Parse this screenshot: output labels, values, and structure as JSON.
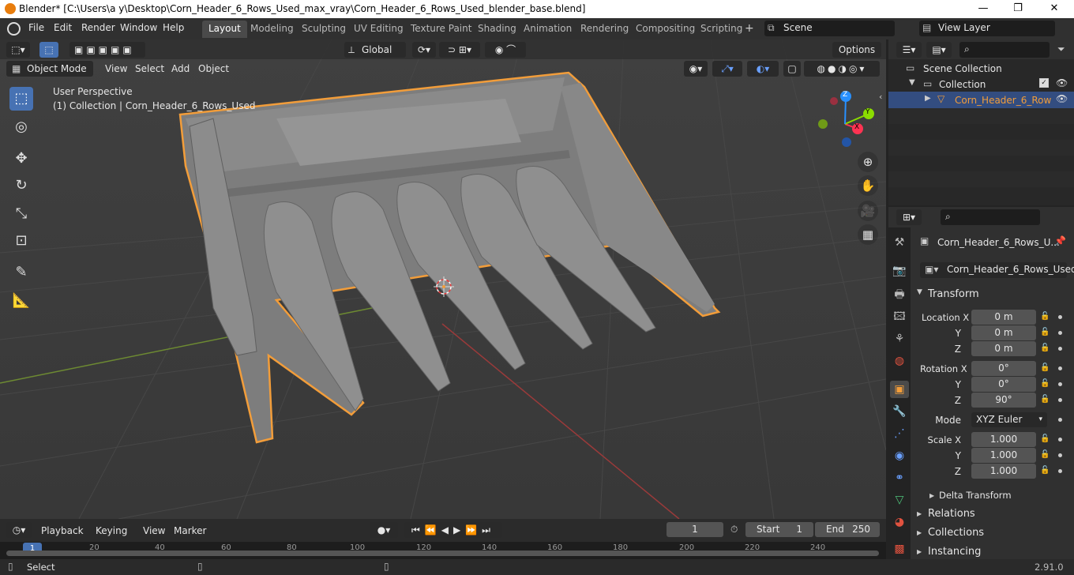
{
  "window": {
    "title": "Blender* [C:\\Users\\a y\\Desktop\\Corn_Header_6_Rows_Used_max_vray\\Corn_Header_6_Rows_Used_blender_base.blend]",
    "minimize": "—",
    "maximize": "❐",
    "close": "✕"
  },
  "menu": [
    "File",
    "Edit",
    "Render",
    "Window",
    "Help"
  ],
  "workspaces": [
    "Layout",
    "Modeling",
    "Sculpting",
    "UV Editing",
    "Texture Paint",
    "Shading",
    "Animation",
    "Rendering",
    "Compositing",
    "Scripting"
  ],
  "scene": "Scene",
  "view_layer": "View Layer",
  "viewport": {
    "orientation": "Global",
    "options_label": "Options",
    "mode": "Object Mode",
    "header_menu": [
      "View",
      "Select",
      "Add",
      "Object"
    ],
    "info_line1": "User Perspective",
    "info_line2": "(1) Collection | Corn_Header_6_Rows_Used",
    "gizmo": {
      "x": "X",
      "y": "Y",
      "z": "Z"
    }
  },
  "outliner": {
    "scene_collection": "Scene Collection",
    "collection": "Collection",
    "object": "Corn_Header_6_Row"
  },
  "properties": {
    "object_title": "Corn_Header_6_Rows_U...",
    "object_name": "Corn_Header_6_Rows_Used",
    "transform_label": "Transform",
    "location": {
      "label": "Location X",
      "y_label": "Y",
      "z_label": "Z",
      "x": "0 m",
      "y": "0 m",
      "z": "0 m"
    },
    "rotation": {
      "label": "Rotation X",
      "y_label": "Y",
      "z_label": "Z",
      "x": "0°",
      "y": "0°",
      "z": "90°"
    },
    "mode": {
      "label": "Mode",
      "value": "XYZ Euler"
    },
    "scale": {
      "label": "Scale X",
      "y_label": "Y",
      "z_label": "Z",
      "x": "1.000",
      "y": "1.000",
      "z": "1.000"
    },
    "delta_transform": "Delta Transform",
    "relations": "Relations",
    "collections": "Collections",
    "instancing": "Instancing"
  },
  "timeline": {
    "menu": [
      "Playback",
      "Keying",
      "View",
      "Marker"
    ],
    "current_frame": "1",
    "start_label": "Start",
    "start": "1",
    "end_label": "End",
    "end": "250",
    "ruler": [
      "1",
      "20",
      "40",
      "60",
      "80",
      "100",
      "120",
      "140",
      "160",
      "180",
      "200",
      "220",
      "240"
    ]
  },
  "status": {
    "left": "Select",
    "version": "2.91.0"
  },
  "colors": {
    "accent": "#4772b3",
    "selection_outline": "#f29d3a",
    "x_axis": "#ff3352",
    "y_axis": "#8bdc00",
    "z_axis": "#2890ff"
  }
}
